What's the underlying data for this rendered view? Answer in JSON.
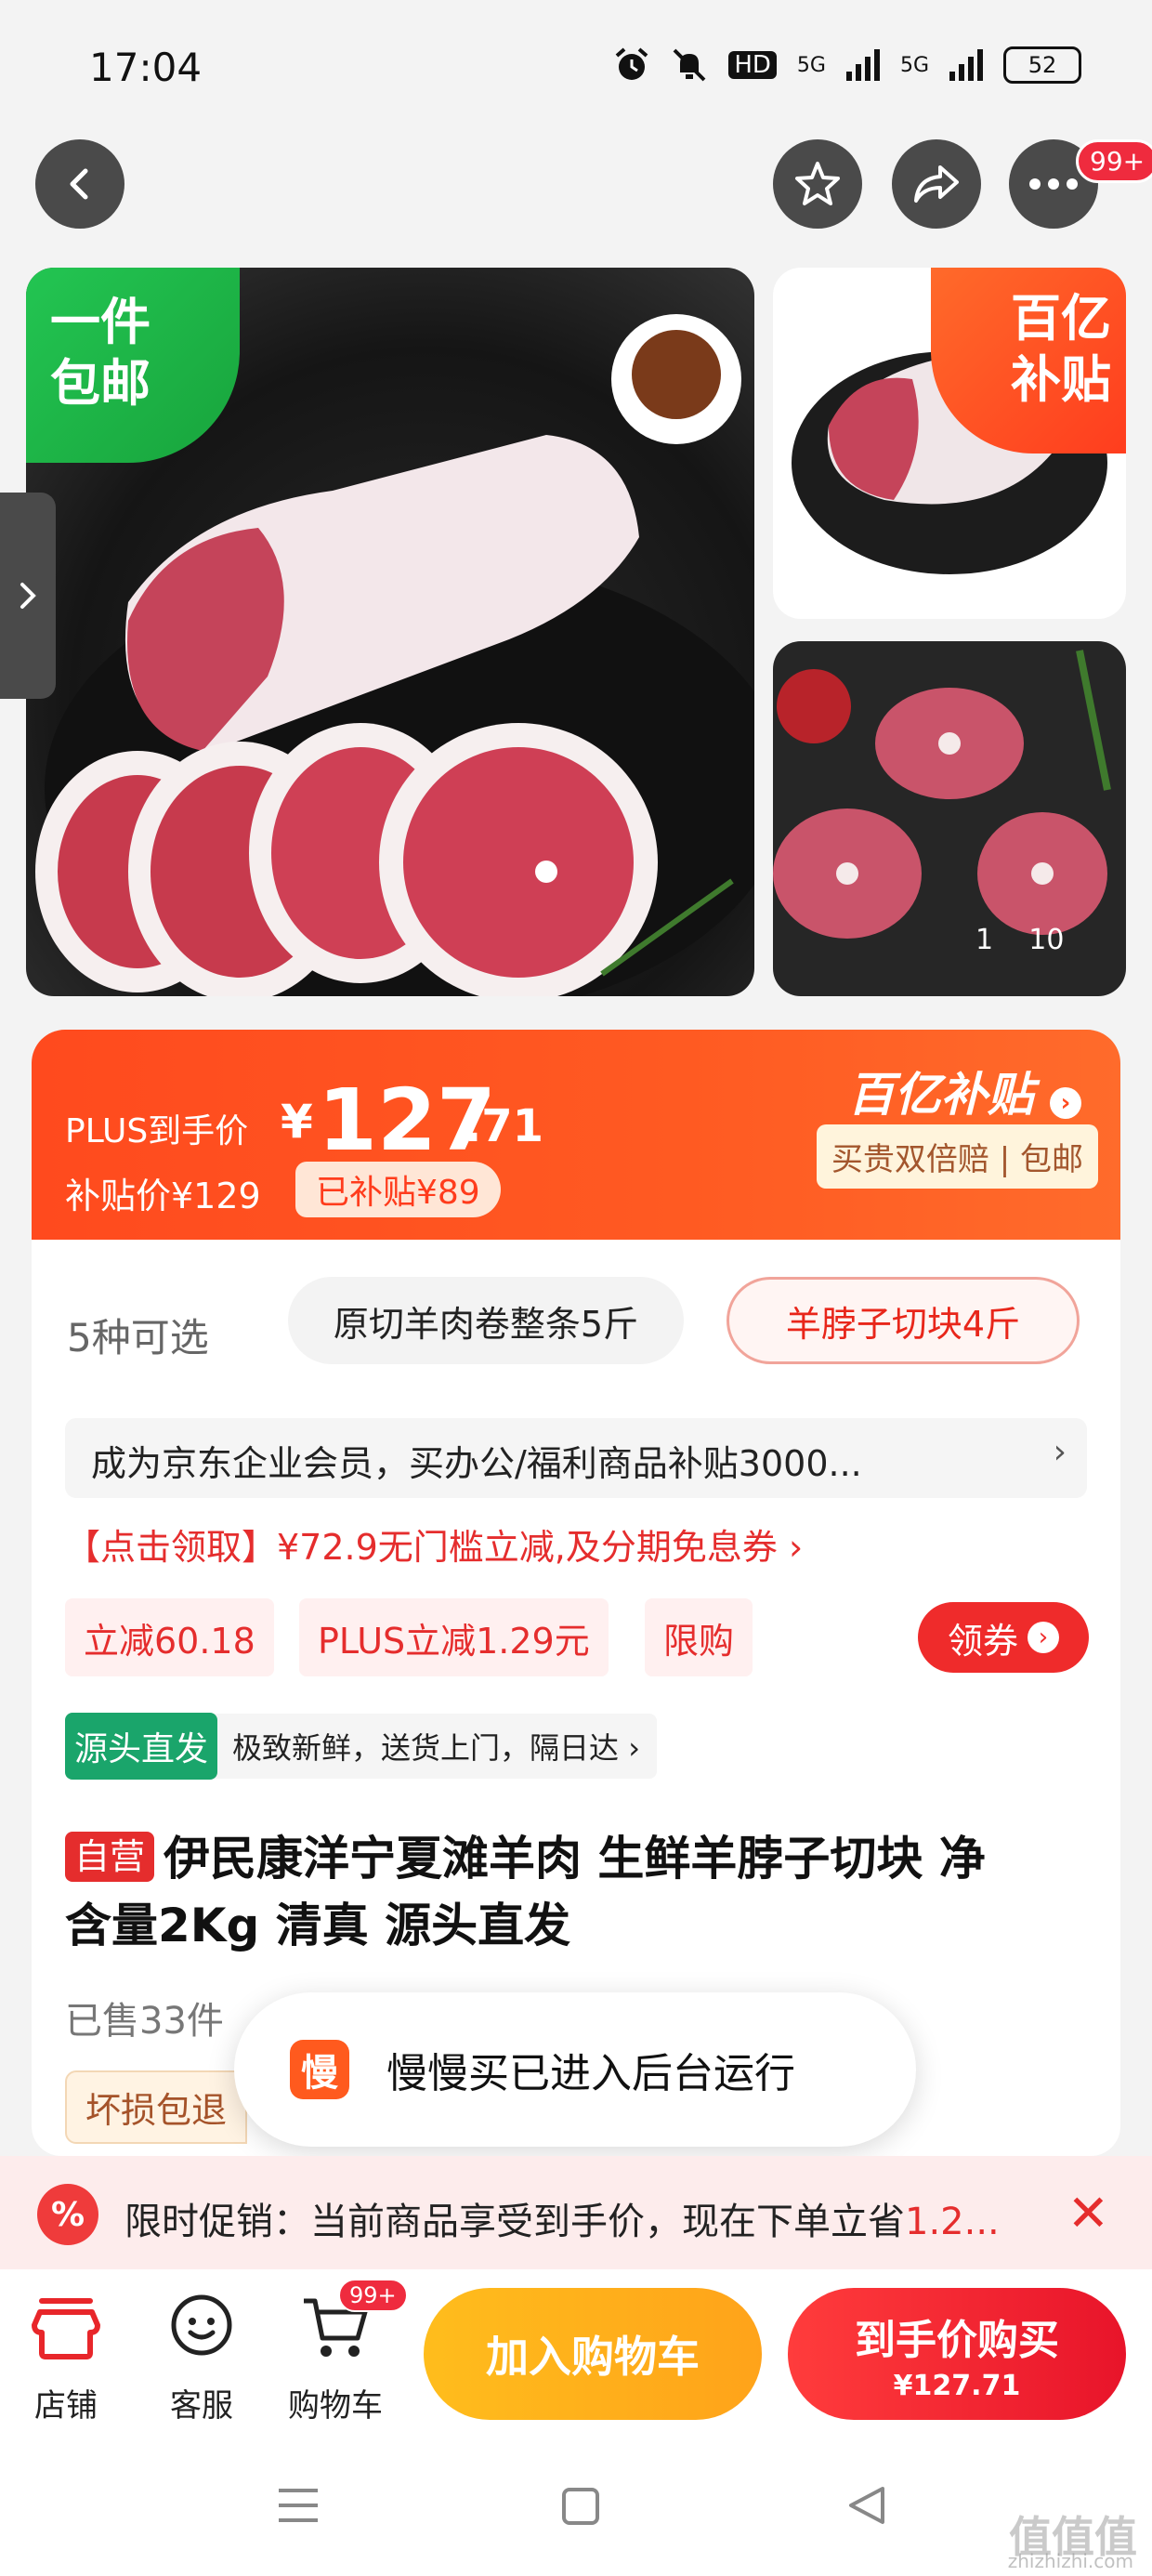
{
  "status_bar": {
    "time": "17:04",
    "network_hd": "HD",
    "net_a": "5G",
    "net_b": "5G",
    "battery": "52"
  },
  "nav": {
    "cart_badge": "99+"
  },
  "gallery": {
    "free_shipping_tag": "一件\n包邮",
    "subsidy_tag_line1": "百亿",
    "subsidy_tag_line2": "补贴",
    "current": "1",
    "total": "10"
  },
  "price": {
    "plus_label": "PLUS到手价",
    "currency": "¥",
    "integer": "127",
    "decimal": ".71",
    "subsidy_price": "补贴价¥129",
    "subsidized": "已补贴¥89",
    "brand": "百亿补贴",
    "guarantee": "买贵双倍赔 | 包邮"
  },
  "variants": {
    "count": "5种可选",
    "options": [
      "原切羊肉卷整条5斤",
      "羊脖子切块4斤"
    ]
  },
  "enterprise_banner": "成为京东企业会员，买办公/福利商品补贴3000...",
  "coupon_line": "【点击领取】¥72.9无门槛立减,及分期免息券 ›",
  "tags": [
    "立减60.18",
    "PLUS立减1.29元",
    "限购"
  ],
  "coupon_button": "领券",
  "source": {
    "badge": "源头直发",
    "text": "极致新鲜，送货上门，隔日达 ›"
  },
  "title": {
    "self_tag": "自营",
    "line1": "伊民康洋宁夏滩羊肉 生鲜羊脖子切块 净",
    "line2": "含量2Kg 清真 源头直发"
  },
  "sold": "已售33件",
  "damage_tag": "坏损包退",
  "toast": {
    "icon": "慢",
    "text": "慢慢买已进入后台运行"
  },
  "promo": {
    "icon": "%",
    "text": "限时促销：当前商品享受到手价，现在下单立省",
    "highlight": "1.2..."
  },
  "bottom": {
    "store": "店铺",
    "service": "客服",
    "cart": "购物车",
    "cart_badge": "99+",
    "add_to_cart": "加入购物车",
    "buy_line1": "到手价购买",
    "buy_line2": "¥127.71"
  },
  "watermark": {
    "main": "值值值",
    "sub": "zhizhizhi.com"
  }
}
